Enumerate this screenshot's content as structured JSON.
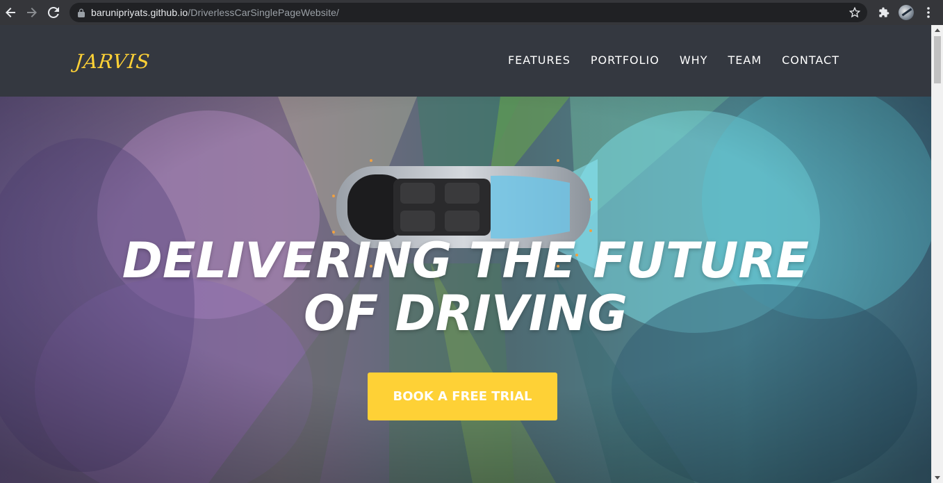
{
  "browser": {
    "url_host": "barunipriyats.github.io",
    "url_path": "/DriverlessCarSinglePageWebsite/",
    "icons": {
      "back": "back-arrow-icon",
      "forward": "forward-arrow-icon",
      "reload": "reload-icon",
      "lock": "lock-icon",
      "bookmark": "star-icon",
      "extensions": "puzzle-icon",
      "profile": "avatar",
      "menu": "kebab-menu-icon"
    }
  },
  "site": {
    "logo": "JARVIS",
    "nav": [
      {
        "label": "FEATURES"
      },
      {
        "label": "PORTFOLIO"
      },
      {
        "label": "WHY"
      },
      {
        "label": "TEAM"
      },
      {
        "label": "CONTACT"
      }
    ],
    "hero": {
      "title_line1": "DELIVERING THE FUTURE",
      "title_line2": "OF DRIVING",
      "cta_label": "BOOK A FREE TRIAL"
    }
  },
  "colors": {
    "header_bg": "#343840",
    "accent_yellow": "#fed136",
    "chrome_bg": "#35363a",
    "omnibox_bg": "#202124"
  }
}
